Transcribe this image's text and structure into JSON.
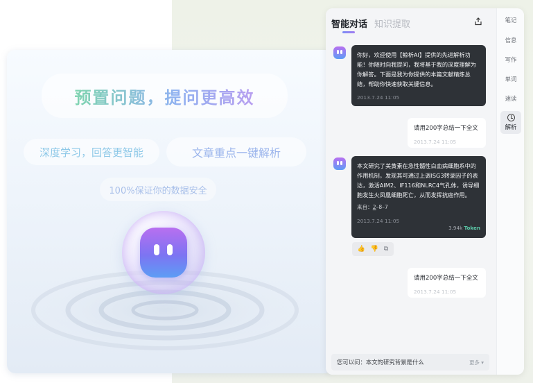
{
  "hero": {
    "headline": "预置问题，提问更高效",
    "feature_a": "深度学习，回答更智能",
    "feature_b": "文章重点一键解析",
    "feature_c": "100%保证你的数据安全"
  },
  "chat": {
    "tabs": [
      {
        "label": "智能对话",
        "active": true
      },
      {
        "label": "知识提取",
        "active": false
      }
    ],
    "messages": [
      {
        "role": "assistant",
        "text": "你好，欢迎使用【鲸析AI】提供的先进解析功能！你随时向我提问，我将基于我的深度理解为你解答。下面是我为你提供的本篇文献精炼总结，帮助你快速获取关键信息。",
        "time": "2013.7.24 11:05"
      },
      {
        "role": "user",
        "text": "请用200字总结一下全文",
        "time": "2013.7.24 11:05"
      },
      {
        "role": "assistant",
        "text": "本文研究了美黄素在急性髓性白血病细胞系中的作用机制，发现其可通过上调ISG3转录因子的表达，激活AIM2、IF116和NLRC4气孔体，诱导细胞发生火凤凰细胞死亡，从而发挥抗癌作用。",
        "source_label": "来自：",
        "source_link": "2",
        "source_rest": "–8–7",
        "time": "2013.7.24 11:05",
        "tokens": "3.94k",
        "tokens_label": "Token"
      },
      {
        "role": "user",
        "text": "请用200字总结一下全文",
        "time": "2013.7.24 11:05"
      }
    ],
    "composer": {
      "suggestion": "您可以问：本文的研究背景是什么",
      "more_label": "更多"
    }
  },
  "sidebar": {
    "items": [
      {
        "label": "笔记"
      },
      {
        "label": "信息"
      },
      {
        "label": "写作"
      },
      {
        "label": "单词"
      },
      {
        "label": "速读"
      },
      {
        "label": "解析",
        "active": true
      }
    ]
  },
  "colors": {
    "bubble_dark": "#2e3237",
    "token_accent": "#5bc9a8",
    "brand_gradient_start": "#b86ff0",
    "brand_gradient_end": "#5d9df5"
  }
}
